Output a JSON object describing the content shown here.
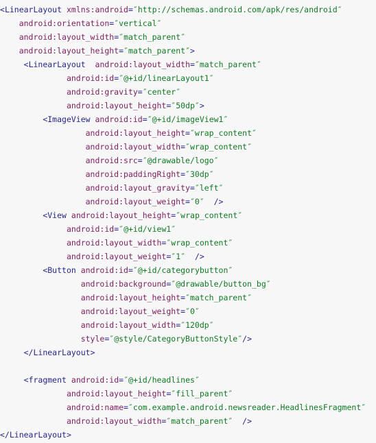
{
  "editor": {
    "language": "xml",
    "background_color": "#f7f7f7",
    "colors": {
      "tag": "#26268c",
      "attribute": "#7d2060",
      "value": "#0f7a23",
      "punctuation": "#26268c"
    }
  },
  "code": {
    "lines": [
      {
        "indent": 0,
        "tokens": [
          {
            "t": "punct",
            "s": "<"
          },
          {
            "t": "tag",
            "s": "LinearLayout"
          },
          {
            "t": "plain",
            "s": " "
          },
          {
            "t": "attr",
            "s": "xmlns:android"
          },
          {
            "t": "eq",
            "s": "="
          },
          {
            "t": "quote",
            "s": "″"
          },
          {
            "t": "val",
            "s": "http://schemas.android.com/apk/res/android"
          },
          {
            "t": "quote",
            "s": "″"
          }
        ]
      },
      {
        "indent": 4,
        "tokens": [
          {
            "t": "attr",
            "s": "android:orientation"
          },
          {
            "t": "eq",
            "s": "="
          },
          {
            "t": "quote",
            "s": "″"
          },
          {
            "t": "val",
            "s": "vertical"
          },
          {
            "t": "quote",
            "s": "″"
          }
        ]
      },
      {
        "indent": 4,
        "tokens": [
          {
            "t": "attr",
            "s": "android:layout_width"
          },
          {
            "t": "eq",
            "s": "="
          },
          {
            "t": "quote",
            "s": "″"
          },
          {
            "t": "val",
            "s": "match_parent"
          },
          {
            "t": "quote",
            "s": "″"
          }
        ]
      },
      {
        "indent": 4,
        "tokens": [
          {
            "t": "attr",
            "s": "android:layout_height"
          },
          {
            "t": "eq",
            "s": "="
          },
          {
            "t": "quote",
            "s": "″"
          },
          {
            "t": "val",
            "s": "match_parent"
          },
          {
            "t": "quote",
            "s": "″"
          },
          {
            "t": "punct",
            "s": ">"
          }
        ]
      },
      {
        "indent": 5,
        "tokens": [
          {
            "t": "punct",
            "s": "<"
          },
          {
            "t": "tag",
            "s": "LinearLayout"
          },
          {
            "t": "plain",
            "s": "  "
          },
          {
            "t": "attr",
            "s": "android:layout_width"
          },
          {
            "t": "eq",
            "s": "="
          },
          {
            "t": "quote",
            "s": "″"
          },
          {
            "t": "val",
            "s": "match_parent"
          },
          {
            "t": "quote",
            "s": "″"
          }
        ]
      },
      {
        "indent": 14,
        "tokens": [
          {
            "t": "attr",
            "s": "android:id"
          },
          {
            "t": "eq",
            "s": "="
          },
          {
            "t": "quote",
            "s": "″"
          },
          {
            "t": "val",
            "s": "@+id/linearLayout1"
          },
          {
            "t": "quote",
            "s": "″"
          }
        ]
      },
      {
        "indent": 14,
        "tokens": [
          {
            "t": "attr",
            "s": "android:gravity"
          },
          {
            "t": "eq",
            "s": "="
          },
          {
            "t": "quote",
            "s": "″"
          },
          {
            "t": "val",
            "s": "center"
          },
          {
            "t": "quote",
            "s": "″"
          }
        ]
      },
      {
        "indent": 14,
        "tokens": [
          {
            "t": "attr",
            "s": "android:layout_height"
          },
          {
            "t": "eq",
            "s": "="
          },
          {
            "t": "quote",
            "s": "″"
          },
          {
            "t": "val",
            "s": "50dp"
          },
          {
            "t": "quote",
            "s": "″"
          },
          {
            "t": "punct",
            "s": ">"
          }
        ]
      },
      {
        "indent": 9,
        "tokens": [
          {
            "t": "punct",
            "s": "<"
          },
          {
            "t": "tag",
            "s": "ImageView"
          },
          {
            "t": "plain",
            "s": " "
          },
          {
            "t": "attr",
            "s": "android:id"
          },
          {
            "t": "eq",
            "s": "="
          },
          {
            "t": "quote",
            "s": "″"
          },
          {
            "t": "val",
            "s": "@+id/imageView1"
          },
          {
            "t": "quote",
            "s": "″"
          }
        ]
      },
      {
        "indent": 18,
        "tokens": [
          {
            "t": "attr",
            "s": "android:layout_height"
          },
          {
            "t": "eq",
            "s": "="
          },
          {
            "t": "quote",
            "s": "″"
          },
          {
            "t": "val",
            "s": "wrap_content"
          },
          {
            "t": "quote",
            "s": "″"
          }
        ]
      },
      {
        "indent": 18,
        "tokens": [
          {
            "t": "attr",
            "s": "android:layout_width"
          },
          {
            "t": "eq",
            "s": "="
          },
          {
            "t": "quote",
            "s": "″"
          },
          {
            "t": "val",
            "s": "wrap_content"
          },
          {
            "t": "quote",
            "s": "″"
          }
        ]
      },
      {
        "indent": 18,
        "tokens": [
          {
            "t": "attr",
            "s": "android:src"
          },
          {
            "t": "eq",
            "s": "="
          },
          {
            "t": "quote",
            "s": "″"
          },
          {
            "t": "val",
            "s": "@drawable/logo"
          },
          {
            "t": "quote",
            "s": "″"
          }
        ]
      },
      {
        "indent": 18,
        "tokens": [
          {
            "t": "attr",
            "s": "android:paddingRight"
          },
          {
            "t": "eq",
            "s": "="
          },
          {
            "t": "quote",
            "s": "″"
          },
          {
            "t": "val",
            "s": "30dp"
          },
          {
            "t": "quote",
            "s": "″"
          }
        ]
      },
      {
        "indent": 18,
        "tokens": [
          {
            "t": "attr",
            "s": "android:layout_gravity"
          },
          {
            "t": "eq",
            "s": "="
          },
          {
            "t": "quote",
            "s": "″"
          },
          {
            "t": "val",
            "s": "left"
          },
          {
            "t": "quote",
            "s": "″"
          }
        ]
      },
      {
        "indent": 18,
        "tokens": [
          {
            "t": "attr",
            "s": "android:layout_weight"
          },
          {
            "t": "eq",
            "s": "="
          },
          {
            "t": "quote",
            "s": "″"
          },
          {
            "t": "val",
            "s": "0"
          },
          {
            "t": "quote",
            "s": "″"
          },
          {
            "t": "punct",
            "s": "  />"
          }
        ]
      },
      {
        "indent": 9,
        "tokens": [
          {
            "t": "punct",
            "s": "<"
          },
          {
            "t": "tag",
            "s": "View"
          },
          {
            "t": "plain",
            "s": " "
          },
          {
            "t": "attr",
            "s": "android:layout_height"
          },
          {
            "t": "eq",
            "s": "="
          },
          {
            "t": "quote",
            "s": "″"
          },
          {
            "t": "val",
            "s": "wrap_content"
          },
          {
            "t": "quote",
            "s": "″"
          }
        ]
      },
      {
        "indent": 14,
        "tokens": [
          {
            "t": "attr",
            "s": "android:id"
          },
          {
            "t": "eq",
            "s": "="
          },
          {
            "t": "quote",
            "s": "″"
          },
          {
            "t": "val",
            "s": "@+id/view1"
          },
          {
            "t": "quote",
            "s": "″"
          }
        ]
      },
      {
        "indent": 14,
        "tokens": [
          {
            "t": "attr",
            "s": "android:layout_width"
          },
          {
            "t": "eq",
            "s": "="
          },
          {
            "t": "quote",
            "s": "″"
          },
          {
            "t": "val",
            "s": "wrap_content"
          },
          {
            "t": "quote",
            "s": "″"
          }
        ]
      },
      {
        "indent": 14,
        "tokens": [
          {
            "t": "attr",
            "s": "android:layout_weight"
          },
          {
            "t": "eq",
            "s": "="
          },
          {
            "t": "quote",
            "s": "″"
          },
          {
            "t": "val",
            "s": "1"
          },
          {
            "t": "quote",
            "s": "″"
          },
          {
            "t": "punct",
            "s": "  />"
          }
        ]
      },
      {
        "indent": 9,
        "tokens": [
          {
            "t": "punct",
            "s": "<"
          },
          {
            "t": "tag",
            "s": "Button"
          },
          {
            "t": "plain",
            "s": " "
          },
          {
            "t": "attr",
            "s": "android:id"
          },
          {
            "t": "eq",
            "s": "="
          },
          {
            "t": "quote",
            "s": "″"
          },
          {
            "t": "val",
            "s": "@+id/categorybutton"
          },
          {
            "t": "quote",
            "s": "″"
          }
        ]
      },
      {
        "indent": 17,
        "tokens": [
          {
            "t": "attr",
            "s": "android:background"
          },
          {
            "t": "eq",
            "s": "="
          },
          {
            "t": "quote",
            "s": "″"
          },
          {
            "t": "val",
            "s": "@drawable/button_bg"
          },
          {
            "t": "quote",
            "s": "″"
          }
        ]
      },
      {
        "indent": 17,
        "tokens": [
          {
            "t": "attr",
            "s": "android:layout_height"
          },
          {
            "t": "eq",
            "s": "="
          },
          {
            "t": "quote",
            "s": "″"
          },
          {
            "t": "val",
            "s": "match_parent"
          },
          {
            "t": "quote",
            "s": "″"
          }
        ]
      },
      {
        "indent": 17,
        "tokens": [
          {
            "t": "attr",
            "s": "android:layout_weight"
          },
          {
            "t": "eq",
            "s": "="
          },
          {
            "t": "quote",
            "s": "″"
          },
          {
            "t": "val",
            "s": "0"
          },
          {
            "t": "quote",
            "s": "″"
          }
        ]
      },
      {
        "indent": 17,
        "tokens": [
          {
            "t": "attr",
            "s": "android:layout_width"
          },
          {
            "t": "eq",
            "s": "="
          },
          {
            "t": "quote",
            "s": "″"
          },
          {
            "t": "val",
            "s": "120dp"
          },
          {
            "t": "quote",
            "s": "″"
          }
        ]
      },
      {
        "indent": 17,
        "tokens": [
          {
            "t": "attr",
            "s": "style"
          },
          {
            "t": "eq",
            "s": "="
          },
          {
            "t": "quote",
            "s": "″"
          },
          {
            "t": "val",
            "s": "@style/CategoryButtonStyle"
          },
          {
            "t": "quote",
            "s": "″"
          },
          {
            "t": "punct",
            "s": "/>"
          }
        ]
      },
      {
        "indent": 5,
        "tokens": [
          {
            "t": "punct",
            "s": "</"
          },
          {
            "t": "tag",
            "s": "LinearLayout"
          },
          {
            "t": "punct",
            "s": ">"
          }
        ]
      },
      {
        "indent": 0,
        "tokens": []
      },
      {
        "indent": 5,
        "tokens": [
          {
            "t": "punct",
            "s": "<"
          },
          {
            "t": "tag",
            "s": "fragment"
          },
          {
            "t": "plain",
            "s": " "
          },
          {
            "t": "attr",
            "s": "android:id"
          },
          {
            "t": "eq",
            "s": "="
          },
          {
            "t": "quote",
            "s": "″"
          },
          {
            "t": "val",
            "s": "@+id/headlines"
          },
          {
            "t": "quote",
            "s": "″"
          }
        ]
      },
      {
        "indent": 14,
        "tokens": [
          {
            "t": "attr",
            "s": "android:layout_height"
          },
          {
            "t": "eq",
            "s": "="
          },
          {
            "t": "quote",
            "s": "″"
          },
          {
            "t": "val",
            "s": "fill_parent"
          },
          {
            "t": "quote",
            "s": "″"
          }
        ]
      },
      {
        "indent": 14,
        "tokens": [
          {
            "t": "attr",
            "s": "android:name"
          },
          {
            "t": "eq",
            "s": "="
          },
          {
            "t": "quote",
            "s": "″"
          },
          {
            "t": "val",
            "s": "com.example.android.newsreader.HeadlinesFragment"
          },
          {
            "t": "quote",
            "s": "″"
          }
        ]
      },
      {
        "indent": 14,
        "tokens": [
          {
            "t": "attr",
            "s": "android:layout_width"
          },
          {
            "t": "eq",
            "s": "="
          },
          {
            "t": "quote",
            "s": "″"
          },
          {
            "t": "val",
            "s": "match_parent"
          },
          {
            "t": "quote",
            "s": "″"
          },
          {
            "t": "punct",
            "s": "  />"
          }
        ]
      },
      {
        "indent": 0,
        "tokens": [
          {
            "t": "punct",
            "s": "</"
          },
          {
            "t": "tag",
            "s": "LinearLayout"
          },
          {
            "t": "punct",
            "s": ">"
          }
        ]
      }
    ]
  }
}
